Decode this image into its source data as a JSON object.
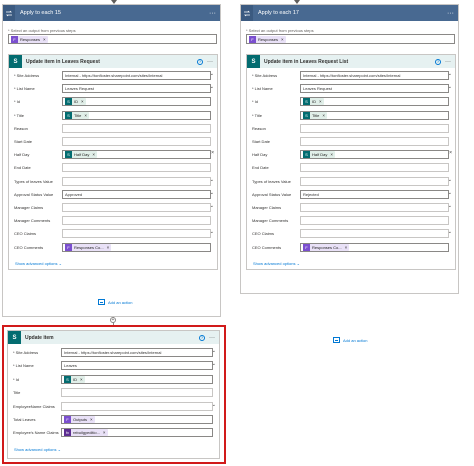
{
  "left_scope": {
    "title": "Apply to each 15",
    "select_label": "* Select an output from previous steps",
    "select_token": "Responses",
    "action": {
      "title": "Update item in Leaves Request",
      "show_advanced": "Show advanced options",
      "rows": [
        {
          "label": "* Site Address",
          "value": "Internal - https://tonfloster.sharepoint.com/sites/Internal",
          "kind": "dropdown"
        },
        {
          "label": "* List Name",
          "value": "Leaves Request",
          "kind": "dropdown"
        },
        {
          "label": "* Id",
          "token": "ID",
          "kind": "token-green"
        },
        {
          "label": "* Title",
          "token": "Title",
          "kind": "token-green"
        },
        {
          "label": "Reason",
          "value": "",
          "kind": "text"
        },
        {
          "label": "Start Date",
          "value": "",
          "kind": "text"
        },
        {
          "label": "Half Day",
          "token": "Half Day",
          "kind": "token-green-x"
        },
        {
          "label": "End Date",
          "value": "",
          "kind": "text"
        },
        {
          "label": "Types of leaves Value",
          "value": "",
          "kind": "dropdown"
        },
        {
          "label": "Approval Status Value",
          "value": "Approved",
          "kind": "dropdown"
        },
        {
          "label": "Manager Claims",
          "value": "",
          "kind": "dropdown"
        },
        {
          "label": "Manager Comments",
          "value": "",
          "kind": "text"
        },
        {
          "label": "CEO Claims",
          "value": "",
          "kind": "dropdown"
        },
        {
          "label": "CEO Comments",
          "token": "Responses Co...",
          "kind": "token-purple"
        }
      ]
    },
    "add_action": "Add an action"
  },
  "right_scope": {
    "title": "Apply to each 17",
    "select_label": "* Select an output from previous steps",
    "select_token": "Responses",
    "action": {
      "title": "Update item in Leaves Request List",
      "show_advanced": "Show advanced options",
      "rows": [
        {
          "label": "* Site Address",
          "value": "Internal - https://tonfloster.sharepoint.com/sites/Internal",
          "kind": "dropdown"
        },
        {
          "label": "* List Name",
          "value": "Leaves Request",
          "kind": "dropdown"
        },
        {
          "label": "* Id",
          "token": "ID",
          "kind": "token-green"
        },
        {
          "label": "* Title",
          "token": "Title",
          "kind": "token-green"
        },
        {
          "label": "Reason",
          "value": "",
          "kind": "text"
        },
        {
          "label": "Start Date",
          "value": "",
          "kind": "text"
        },
        {
          "label": "Half Day",
          "token": "Half Day",
          "kind": "token-green-x"
        },
        {
          "label": "End Date",
          "value": "",
          "kind": "text"
        },
        {
          "label": "Types of leaves Value",
          "value": "",
          "kind": "dropdown"
        },
        {
          "label": "Approval Status Value",
          "value": "Rejected",
          "kind": "dropdown"
        },
        {
          "label": "Manager Claims",
          "value": "",
          "kind": "dropdown"
        },
        {
          "label": "Manager Comments",
          "value": "",
          "kind": "text"
        },
        {
          "label": "CEO Claims",
          "value": "",
          "kind": "dropdown"
        },
        {
          "label": "CEO Comments",
          "token": "Responses Co...",
          "kind": "token-purple"
        }
      ]
    },
    "add_action": "Add an action"
  },
  "update_item": {
    "title": "Update item",
    "show_advanced": "Show advanced options",
    "rows": [
      {
        "label": "* Site Address",
        "value": "Internal - https://tonfloster.sharepoint.com/sites/Internal",
        "kind": "dropdown"
      },
      {
        "label": "* List Name",
        "value": "Leaves",
        "kind": "dropdown"
      },
      {
        "label": "* Id",
        "token": "ID",
        "kind": "token-green"
      },
      {
        "label": "Title",
        "value": "",
        "kind": "text"
      },
      {
        "label": "EmployeeName Claims",
        "value": "",
        "kind": "dropdown"
      },
      {
        "label": "Total Leaves",
        "token": "Outputs",
        "kind": "token-purple"
      },
      {
        "label": "Employee's Name Claims",
        "token": "rebuilgyeditio...",
        "kind": "token-purple-fx"
      }
    ]
  },
  "colors": {
    "scope_header": "#486991",
    "sharepoint": "#036c70",
    "link": "#0078d4",
    "highlight": "#d11a1a"
  }
}
